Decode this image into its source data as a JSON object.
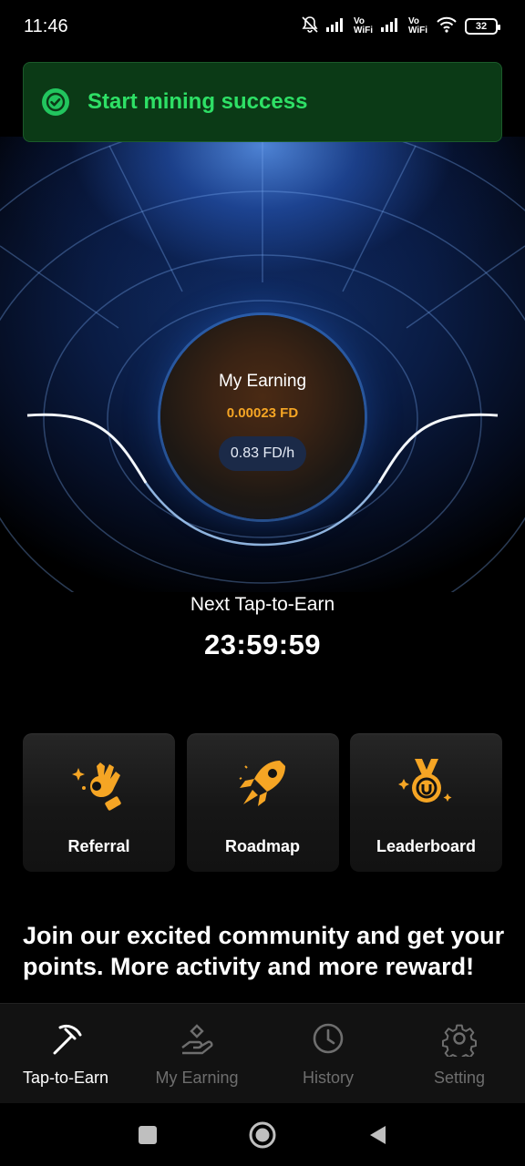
{
  "status_bar": {
    "time": "11:46",
    "volte_1": "Vo WiFi",
    "volte_2": "Vo WiFi",
    "battery_level": "32"
  },
  "toast": {
    "message": "Start mining success",
    "icon": "check-circle-icon",
    "color": "#2ee066"
  },
  "earning": {
    "title": "My Earning",
    "value": "0.00023 FD",
    "rate": "0.83 FD/h",
    "accent_color": "#f5a524"
  },
  "timer": {
    "label": "Next Tap-to-Earn",
    "countdown": "23:59:59"
  },
  "cards": [
    {
      "label": "Referral",
      "icon": "ok-hand-sparkle-icon"
    },
    {
      "label": "Roadmap",
      "icon": "rocket-icon"
    },
    {
      "label": "Leaderboard",
      "icon": "medal-icon"
    }
  ],
  "promo": {
    "text": "Join our excited community and get your points. More activity and more reward!"
  },
  "tabs": [
    {
      "label": "Tap-to-Earn",
      "icon": "pickaxe-icon",
      "active": true
    },
    {
      "label": "My Earning",
      "icon": "hand-coin-icon",
      "active": false
    },
    {
      "label": "History",
      "icon": "clock-icon",
      "active": false
    },
    {
      "label": "Setting",
      "icon": "gear-icon",
      "active": false
    }
  ],
  "system_nav": [
    "recents-button",
    "home-button",
    "back-button"
  ]
}
